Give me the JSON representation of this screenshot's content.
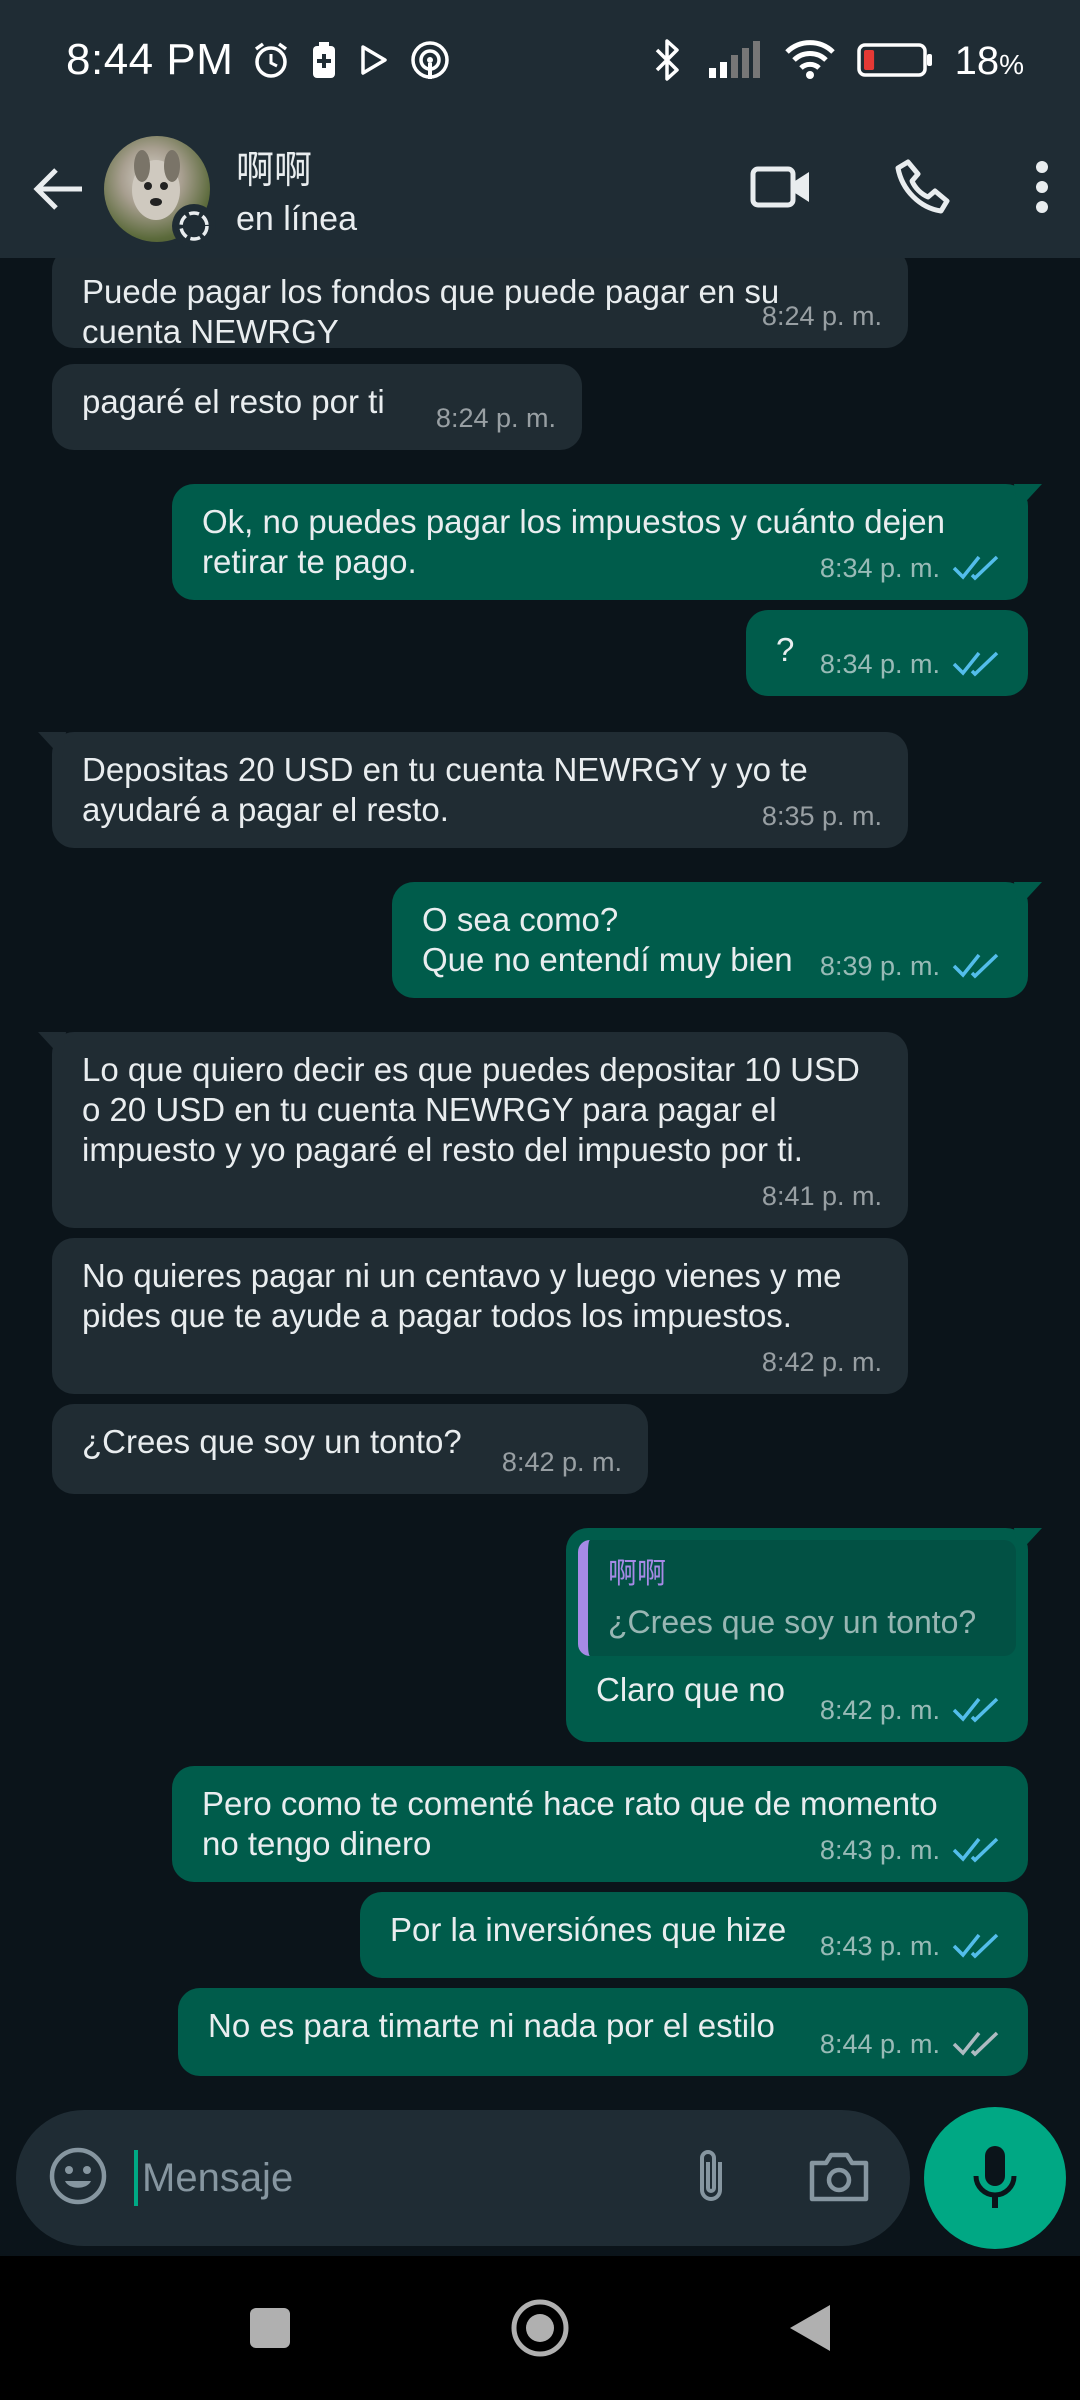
{
  "status_bar": {
    "time": "8:44 PM",
    "battery": "18",
    "battery_unit": "%",
    "battery_level": 0.18,
    "battery_color": "#e53935"
  },
  "header": {
    "contact_name": "啊啊",
    "contact_status": "en línea",
    "icons": [
      "back-arrow-icon",
      "avatar",
      "video-call-icon",
      "phone-icon",
      "more-vert-icon"
    ]
  },
  "messages": [
    {
      "dir": "in",
      "text": "Puede pagar los fondos que puede pagar en su cuenta NEWRGY",
      "time": "8:24 p. m."
    },
    {
      "dir": "in",
      "text": "pagaré el resto por ti",
      "time": "8:24 p. m."
    },
    {
      "dir": "out",
      "text": "Ok, no puedes pagar los impuestos y cuánto dejen retirar te pago.",
      "time": "8:34 p. m.",
      "status": "read"
    },
    {
      "dir": "out",
      "text": "?",
      "time": "8:34 p. m.",
      "status": "read"
    },
    {
      "dir": "in",
      "text": "Depositas 20 USD en tu cuenta NEWRGY y yo te ayudaré a pagar el resto.",
      "time": "8:35 p. m."
    },
    {
      "dir": "out",
      "line1": "O sea como?",
      "line2": "Que no entendí muy bien",
      "time": "8:39 p. m.",
      "status": "read"
    },
    {
      "dir": "in",
      "text": "Lo que quiero decir es que puedes depositar 10 USD o 20 USD en tu cuenta NEWRGY para pagar el impuesto y yo pagaré el resto del impuesto por ti.",
      "time": "8:41 p. m."
    },
    {
      "dir": "in",
      "text": "No quieres pagar ni un centavo y luego vienes y me pides que te ayude a pagar todos los impuestos.",
      "time": "8:42 p. m."
    },
    {
      "dir": "in",
      "text": "¿Crees que soy un tonto?",
      "time": "8:42 p. m."
    },
    {
      "dir": "out",
      "quote_name": "啊啊",
      "quote_text": "¿Crees que soy un tonto?",
      "text": "Claro que no",
      "time": "8:42 p. m.",
      "status": "read"
    },
    {
      "dir": "out",
      "text": "Pero como te comenté hace rato que de momento no tengo dinero",
      "time": "8:43 p. m.",
      "status": "read"
    },
    {
      "dir": "out",
      "text": "Por la inversiónes que hize",
      "time": "8:43 p. m.",
      "status": "read"
    },
    {
      "dir": "out",
      "text": "No es para timarte ni nada por el estilo",
      "time": "8:44 p. m.",
      "status": "delivered"
    }
  ],
  "composer": {
    "placeholder": "Mensaje",
    "icons": [
      "emoji-icon",
      "attach-icon",
      "camera-icon",
      "mic-icon"
    ]
  },
  "colors": {
    "background": "#0b141a",
    "header": "#1f2c34",
    "incoming_bubble": "#202c33",
    "outgoing_bubble": "#005c4b",
    "accent": "#00a884",
    "read_tick": "#53bdeb",
    "quote_accent": "#a78ae6"
  }
}
